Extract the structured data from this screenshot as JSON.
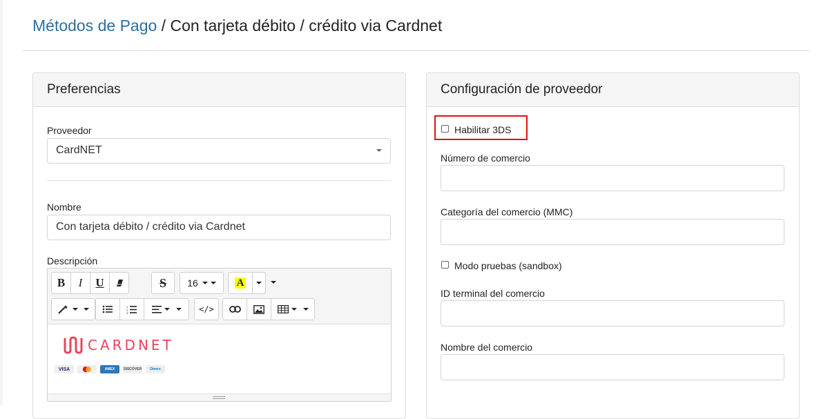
{
  "breadcrumb": {
    "link": "Métodos de Pago",
    "separator": " / ",
    "current": "Con tarjeta débito / crédito via Cardnet"
  },
  "preferences": {
    "title": "Preferencias",
    "provider_label": "Proveedor",
    "provider_value": "CardNET",
    "name_label": "Nombre",
    "name_value": "Con tarjeta débito / crédito via Cardnet",
    "description_label": "Descripción",
    "editor": {
      "font_size": "16",
      "highlight_letter": "A",
      "code_label": "</>",
      "bold": "B",
      "italic": "I",
      "underline": "U",
      "strike": "S",
      "logo_text": "CARDNET",
      "card_logos": [
        "VISA",
        "MC",
        "AMEX",
        "DISCOVER",
        "Diners"
      ]
    }
  },
  "provider_config": {
    "title": "Configuración de proveedor",
    "enable_3ds_label": "Habilitar 3DS",
    "enable_3ds_checked": false,
    "merchant_number_label": "Número de comercio",
    "merchant_number_value": "",
    "merchant_category_label": "Categoría del comercio (MMC)",
    "merchant_category_value": "",
    "sandbox_label": "Modo pruebas (sandbox)",
    "sandbox_checked": false,
    "terminal_id_label": "ID terminal del comercio",
    "terminal_id_value": "",
    "merchant_name_label": "Nombre del comercio",
    "merchant_name_value": ""
  },
  "colors": {
    "link": "#2e6e9e",
    "highlight_box": "#e01010",
    "cardnet_pink": "#e8455a"
  }
}
